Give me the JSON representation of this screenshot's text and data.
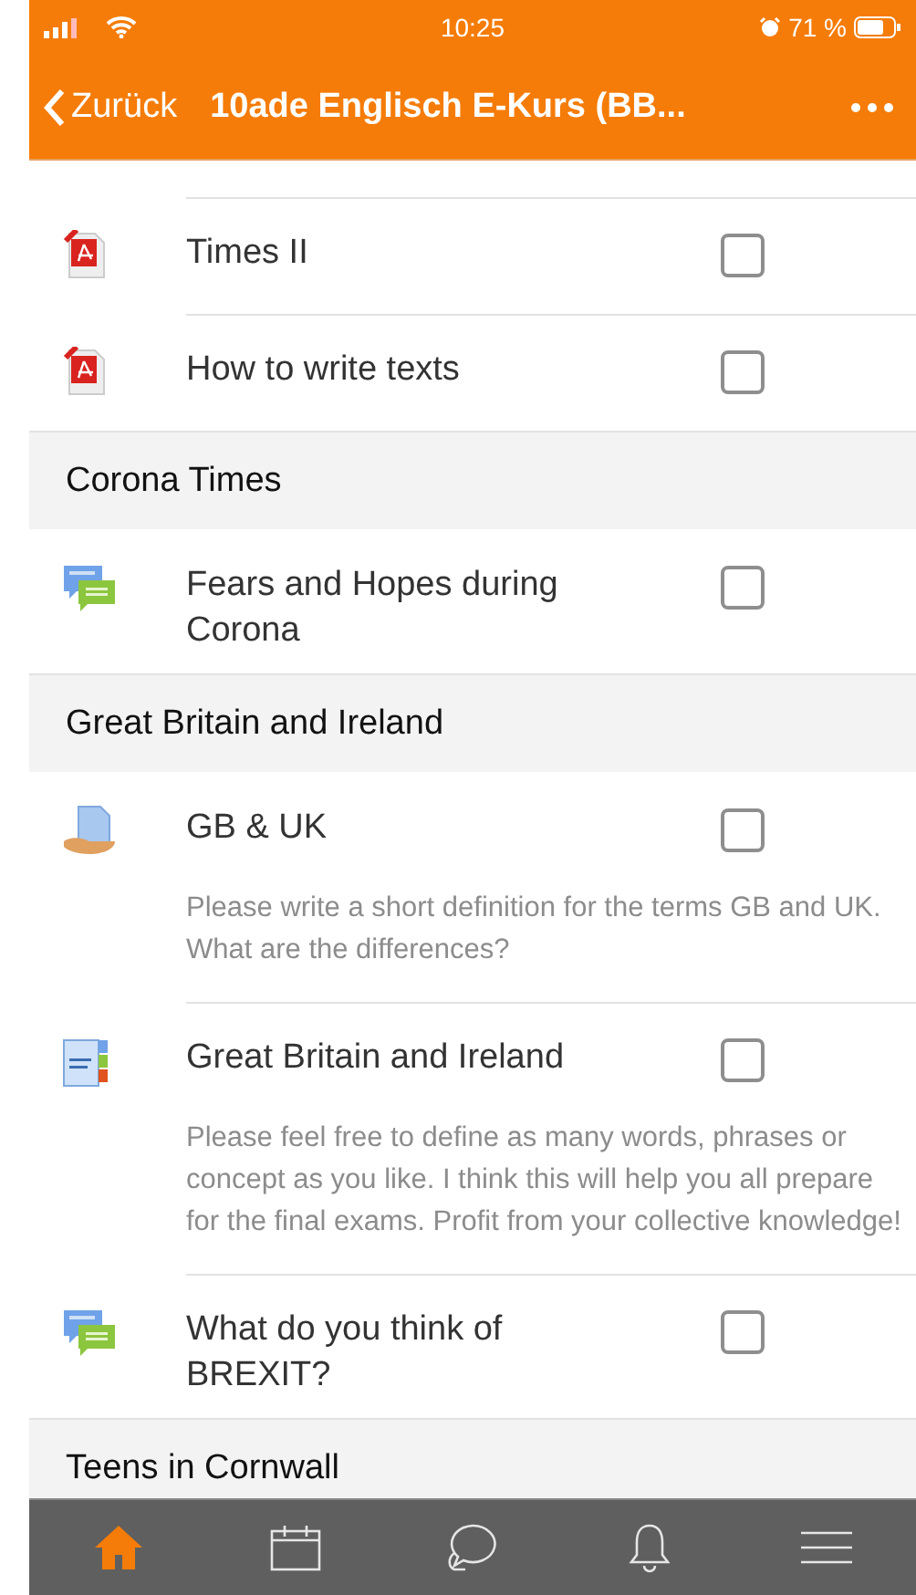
{
  "status_bar": {
    "time": "10:25",
    "battery": "71 %"
  },
  "nav_bar": {
    "back": "Zurück",
    "title": "10ade Englisch E-Kurs (BB..."
  },
  "items": [
    {
      "kind": "resource",
      "title": "Times II",
      "checked": false
    },
    {
      "kind": "resource",
      "title": "How to write texts",
      "checked": false
    },
    {
      "kind": "section",
      "title": "Corona Times"
    },
    {
      "kind": "forum",
      "title": "Fears and Hopes during Corona",
      "checked": false
    },
    {
      "kind": "section",
      "title": "Great Britain and Ireland"
    },
    {
      "kind": "assignment",
      "title": "GB & UK",
      "checked": false,
      "description": "Please write a short definition for the terms GB and UK. What are the differences?"
    },
    {
      "kind": "glossary",
      "title": "Great Britain and Ireland",
      "checked": false,
      "description": "Please feel free to define as many words, phrases or concept as you like. I think this will help you all prepare for the final exams. Profit from your collective knowledge!"
    },
    {
      "kind": "forum",
      "title": "What do you think of BREXIT?",
      "checked": false
    },
    {
      "kind": "section",
      "title": "Teens in Cornwall"
    }
  ],
  "tab_bar": [
    {
      "kind": "home",
      "selected": true
    },
    {
      "kind": "calendar",
      "selected": false
    },
    {
      "kind": "messages",
      "selected": false
    },
    {
      "kind": "notifications",
      "selected": false
    },
    {
      "kind": "menu",
      "selected": false
    }
  ]
}
